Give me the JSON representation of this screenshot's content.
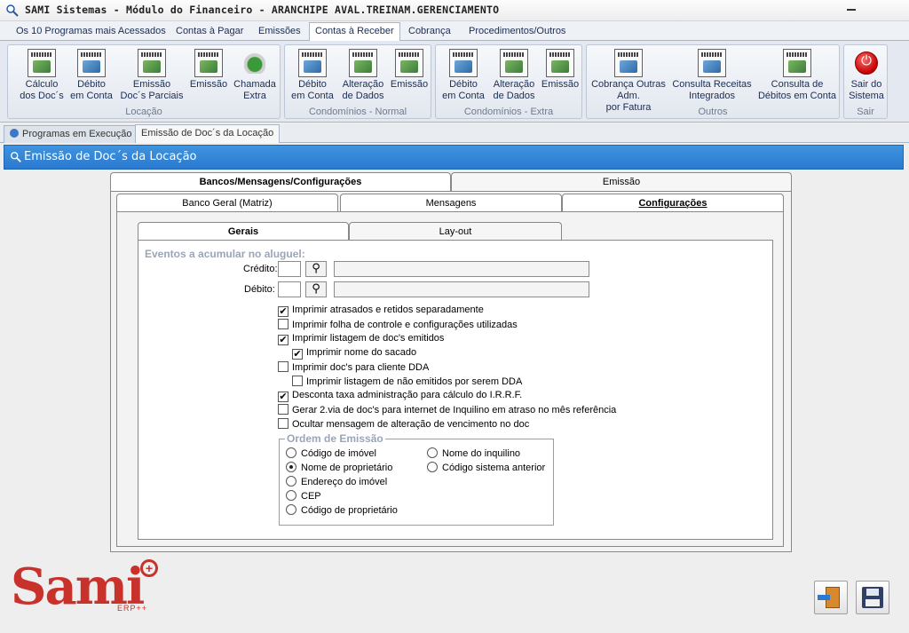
{
  "window": {
    "title": "SAMI Sistemas - Módulo do Financeiro - ARANCHIPE AVAL.TREINAM.GERENCIAMENTO"
  },
  "menu_tabs": [
    "Os 10 Programas mais Acessados",
    "Contas à Pagar",
    "Emissões",
    "Contas à Receber",
    "Cobrança",
    "Procedimentos/Outros"
  ],
  "ribbon": {
    "groups": [
      {
        "title": "Locação",
        "buttons": [
          "Cálculo dos Doc´s",
          "Débito em Conta",
          "Emissão Doc´s Parciais",
          "Emissão",
          "Chamada Extra"
        ]
      },
      {
        "title": "Condomínios - Normal",
        "buttons": [
          "Débito em Conta",
          "Alteração de Dados",
          "Emissão"
        ]
      },
      {
        "title": "Condomínios - Extra",
        "buttons": [
          "Débito em Conta",
          "Alteração de Dados",
          "Emissão"
        ]
      },
      {
        "title": "Outros",
        "buttons": [
          "Cobrança Outras Adm. por Fatura",
          "Consulta Receitas Integrados",
          "Consulta de Débitos em Conta"
        ]
      },
      {
        "title": "Sair",
        "buttons": [
          "Sair do Sistema"
        ]
      }
    ],
    "lines": {
      "calc": [
        "Cálculo",
        "dos Doc´s"
      ],
      "debito": [
        "Débito",
        "em Conta"
      ],
      "emissao_parc": [
        "Emissão",
        "Doc´s Parciais"
      ],
      "emissao": "Emissão",
      "chamada": [
        "Chamada",
        "Extra"
      ],
      "alteracao": [
        "Alteração",
        "de Dados"
      ],
      "cobranca": [
        "Cobrança Outras",
        "Adm.",
        "por Fatura"
      ],
      "consulta_rec": [
        "Consulta Receitas",
        "Integrados"
      ],
      "consulta_deb": [
        "Consulta de",
        "Débitos em Conta"
      ],
      "sair": [
        "Sair do",
        "Sistema"
      ]
    }
  },
  "doc_tabs": [
    "Programas em Execução",
    "Emissão de Doc´s da Locação"
  ],
  "form": {
    "title": "Emissão de Doc´s da Locação",
    "top_tabs": [
      "Bancos/Mensagens/Configurações",
      "Emissão"
    ],
    "mid_tabs": [
      "Banco Geral (Matriz)",
      "Mensagens",
      "Configurações"
    ],
    "inner_tabs": [
      "Gerais",
      "Lay-out"
    ],
    "section_title": "Eventos a acumular no aluguel:",
    "credito_label": "Crédito:",
    "debito_label": "Débito:",
    "checkboxes": [
      {
        "label": "Imprimir atrasados e retidos separadamente",
        "checked": true
      },
      {
        "label": "Imprimir folha de controle e configurações utilizadas",
        "checked": false
      },
      {
        "label": "Imprimir listagem de doc's emitidos",
        "checked": true
      },
      {
        "label": "Imprimir nome do sacado",
        "checked": true
      },
      {
        "label": "Imprimir doc's para cliente DDA",
        "checked": false
      },
      {
        "label": "Imprimir listagem de não emitidos por serem DDA",
        "checked": false
      },
      {
        "label": "Desconta taxa administração para cálculo do I.R.R.F.",
        "checked": true
      },
      {
        "label": "Gerar 2.via de doc's para internet de Inquilino em atraso no mês referência",
        "checked": false
      },
      {
        "label": "Ocultar mensagem de alteração de vencimento no doc",
        "checked": false
      }
    ],
    "ordem": {
      "legend": "Ordem de Emissão",
      "options": [
        "Código de imóvel",
        "Nome de proprietário",
        "Endereço do imóvel",
        "CEP",
        "Código de proprietário",
        "Nome do inquilino",
        "Código sistema anterior"
      ],
      "selected": "Nome de proprietário"
    }
  },
  "logo": {
    "text": "Sami",
    "sub": "ERP++"
  },
  "colors": {
    "header_blue": "#2a7ad0",
    "logo_red": "#c9312b"
  }
}
